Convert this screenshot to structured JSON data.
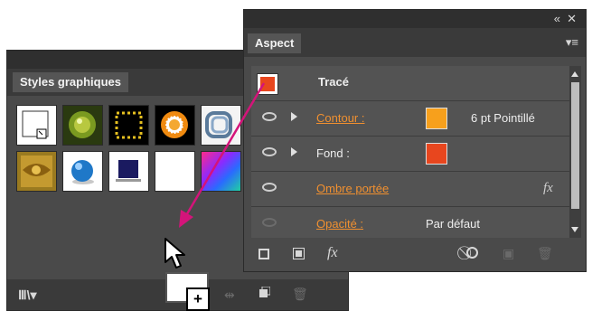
{
  "styles_panel": {
    "title": "Styles graphiques",
    "swatches": [
      "default-style",
      "green-gem",
      "dotted-square",
      "sun-burst",
      "blue-rings",
      "gold-texture",
      "blue-sphere",
      "navy-square",
      "blank",
      "rainbow-gradient"
    ],
    "icon_library": "library-menu-icon",
    "icon_break_link": "break-link-icon",
    "icon_new": "new-style-icon",
    "icon_delete": "trash-icon"
  },
  "aspect_panel": {
    "title": "Aspect",
    "rows": [
      {
        "label": "Tracé",
        "value": "",
        "color": "#e8461e"
      },
      {
        "label": "Contour :",
        "value": "6 pt Pointillé",
        "color": "#f7a01c"
      },
      {
        "label": "Fond :",
        "value": "",
        "color": "#e8461e"
      },
      {
        "label": "Ombre portée",
        "value": "",
        "fx": "fx"
      },
      {
        "label": "Opacité :",
        "value": "Par défaut"
      }
    ],
    "footer_fx": "fx"
  },
  "drag_badge": "+",
  "colors": {
    "accent_orange": "#f09030",
    "arrow_magenta": "#d4147a",
    "panel_bg": "#4a4a4a"
  }
}
